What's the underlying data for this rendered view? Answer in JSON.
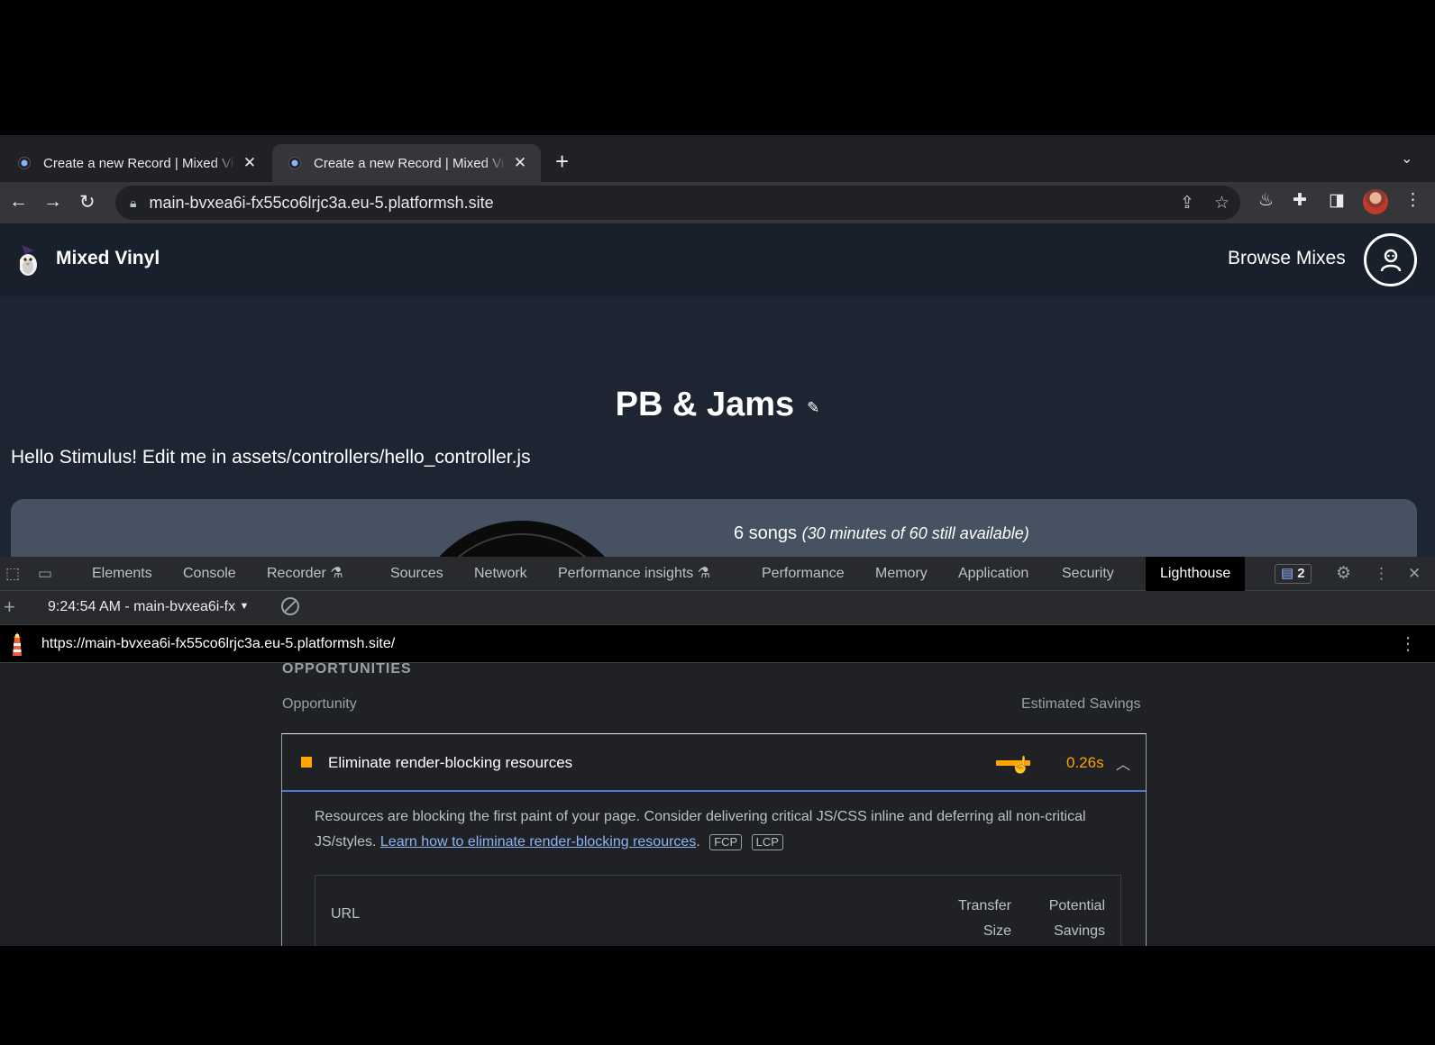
{
  "browser": {
    "tabs": [
      {
        "title": "Create a new Record | Mixed Vi"
      },
      {
        "title": "Create a new Record | Mixed Vi"
      }
    ],
    "address": "main-bvxea6i-fx55co6lrjc3a.eu-5.platformsh.site"
  },
  "site": {
    "brand": "Mixed Vinyl",
    "nav_link": "Browse Mixes",
    "headline": "PB & Jams",
    "hello": "Hello Stimulus! Edit me in assets/controllers/hello_controller.js",
    "songs_count": "6 songs",
    "songs_note": "(30 minutes of 60 still available)"
  },
  "devtools": {
    "tabs": {
      "elements": "Elements",
      "console": "Console",
      "recorder": "Recorder",
      "sources": "Sources",
      "network": "Network",
      "perf_insights": "Performance insights",
      "performance": "Performance",
      "memory": "Memory",
      "application": "Application",
      "security": "Security",
      "lighthouse": "Lighthouse"
    },
    "issues_count": "2",
    "report_selector": "9:24:54 AM - main-bvxea6i-fx",
    "report_url": "https://main-bvxea6i-fx55co6lrjc3a.eu-5.platformsh.site/"
  },
  "lighthouse": {
    "section_heading": "OPPORTUNITIES",
    "col_opportunity": "Opportunity",
    "col_savings": "Estimated Savings",
    "audit": {
      "title": "Eliminate render-blocking resources",
      "savings": "0.26s",
      "savings_level": 1.0,
      "status_color": "#ffa400",
      "description": "Resources are blocking the first paint of your page. Consider delivering critical JS/CSS inline and deferring all non-critical JS/styles. ",
      "link_text": "Learn how to eliminate render-blocking resources",
      "after_link": ".",
      "badges": [
        "FCP",
        "LCP"
      ]
    },
    "table": {
      "col_url": "URL",
      "col_transfer_1": "Transfer",
      "col_transfer_2": "Size",
      "col_potential_1": "Potential",
      "col_potential_2": "Savings"
    }
  }
}
